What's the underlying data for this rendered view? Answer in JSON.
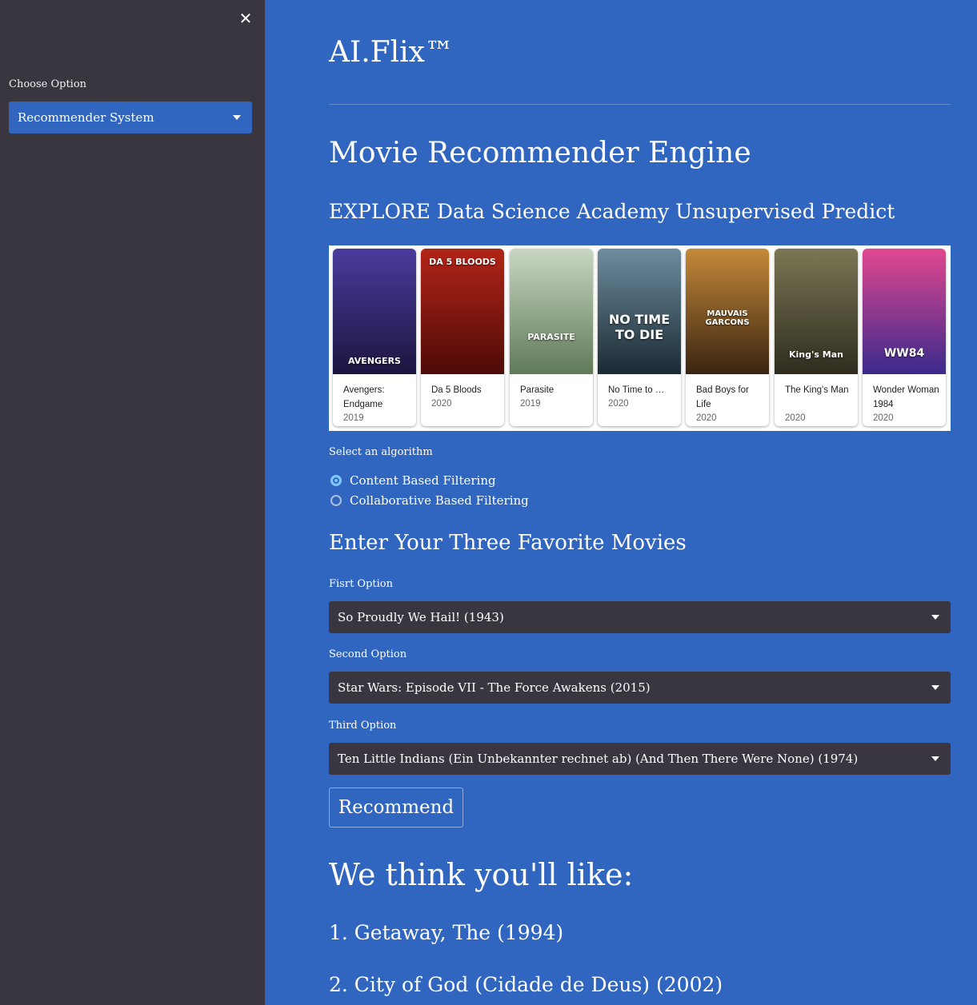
{
  "sidebar": {
    "close_glyph": "✕",
    "label": "Choose Option",
    "select_value": "Recommender System"
  },
  "header": {
    "title": "AI.Flix™"
  },
  "main": {
    "heading": "Movie Recommender Engine",
    "subheading": "EXPLORE Data Science Academy Unsupervised Predict",
    "movies": [
      {
        "title": "Avengers: Endgame",
        "year": "2019",
        "poster_text": "AVENGERS",
        "color_top": "#4a3a9c",
        "color_bottom": "#1d1540"
      },
      {
        "title": "Da 5 Bloods",
        "year": "2020",
        "poster_text": "DA 5 BLOODS",
        "color_top": "#b32418",
        "color_bottom": "#4e0b07"
      },
      {
        "title": "Parasite",
        "year": "2019",
        "poster_text": "PARASITE",
        "color_top": "#c9d7c2",
        "color_bottom": "#5f7a57"
      },
      {
        "title": "No Time to …",
        "year": "2020",
        "poster_text": "NO TIME TO DIE",
        "color_top": "#6d8d9e",
        "color_bottom": "#1b2a33"
      },
      {
        "title": "Bad Boys for Life",
        "year": "2020",
        "poster_text": "MAUVAIS GARCONS",
        "color_top": "#c58a3a",
        "color_bottom": "#3a2410"
      },
      {
        "title": "The King's Man",
        "year": "2020",
        "poster_text": "King's Man",
        "color_top": "#7b7654",
        "color_bottom": "#2e2c1e"
      },
      {
        "title": "Wonder Woman 1984",
        "year": "2020",
        "poster_text": "WW84",
        "color_top": "#e2478f",
        "color_bottom": "#3a2a8c"
      }
    ],
    "algo_label": "Select an algorithm",
    "algos": [
      {
        "label": "Content Based Filtering",
        "selected": true
      },
      {
        "label": "Collaborative Based Filtering",
        "selected": false
      }
    ],
    "fav_heading": "Enter Your Three Favorite Movies",
    "options": [
      {
        "label": "Fisrt Option",
        "value": "So Proudly We Hail! (1943)"
      },
      {
        "label": "Second Option",
        "value": "Star Wars: Episode VII - The Force Awakens (2015)"
      },
      {
        "label": "Third Option",
        "value": "Ten Little Indians (Ein Unbekannter rechnet ab) (And Then There Were None) (1974)"
      }
    ],
    "recommend_label": "Recommend",
    "results_heading": "We think you'll like:",
    "results": [
      "1. Getaway, The (1994)",
      "2. City of God (Cidade de Deus) (2002)"
    ]
  },
  "colors": {
    "sidebar_bg": "#393640",
    "main_bg": "#3066c0",
    "select_bg": "#393640",
    "radio_active": "#7ec8ff"
  }
}
